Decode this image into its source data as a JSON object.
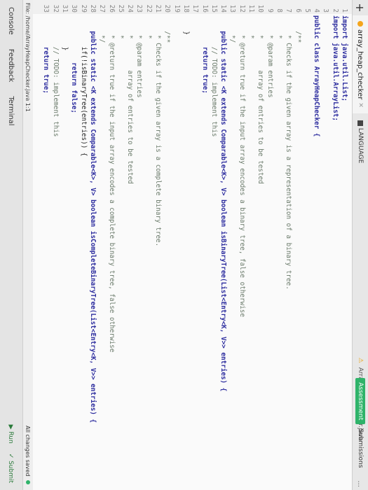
{
  "tabs": {
    "add": "+",
    "active_file": "array_heap_checker",
    "language_label": "LANGUAGE",
    "open_file": "ArrayHeapChecker.java"
  },
  "header": {
    "assessment_label": "Assessment",
    "submissions_label": "Submissions",
    "more": "..."
  },
  "code": {
    "lines": [
      {
        "n": "1",
        "t": "import java.util.List;"
      },
      {
        "n": "2",
        "t": "import java.util.ArrayList;"
      },
      {
        "n": "3",
        "t": ""
      },
      {
        "n": "4",
        "t": "public class ArrayHeapChecker {"
      },
      {
        "n": "5",
        "t": ""
      },
      {
        "n": "6",
        "t": "    /**"
      },
      {
        "n": "7",
        "t": "     * Checks if the given array is a representation of a binary tree."
      },
      {
        "n": "8",
        "t": "     *"
      },
      {
        "n": "9",
        "t": "     * @param entries"
      },
      {
        "n": "10",
        "t": "     *        array of entries to be tested"
      },
      {
        "n": "11",
        "t": "     *"
      },
      {
        "n": "12",
        "t": "     * @return true if the input array encodes a binary tree, false otherwise"
      },
      {
        "n": "13",
        "t": "     */"
      },
      {
        "n": "14",
        "t": "    public static <K extends Comparable<K>, V> boolean isBinaryTree(List<Entry<K, V>> entries) {"
      },
      {
        "n": "15",
        "t": "        // TODO: implement this"
      },
      {
        "n": "16",
        "t": "        return true;"
      },
      {
        "n": "17",
        "t": ""
      },
      {
        "n": "18",
        "t": "    }"
      },
      {
        "n": "19",
        "t": ""
      },
      {
        "n": "20",
        "t": "    /**"
      },
      {
        "n": "21",
        "t": "     * Checks if the given array is a complete binary tree."
      },
      {
        "n": "22",
        "t": "     *"
      },
      {
        "n": "23",
        "t": "     * @param entries"
      },
      {
        "n": "24",
        "t": "     *        array of entries to be tested"
      },
      {
        "n": "25",
        "t": "     *"
      },
      {
        "n": "26",
        "t": "     * @return true if the input array encodes a complete binary tree, false otherwise"
      },
      {
        "n": "27",
        "t": "     */"
      },
      {
        "n": "28",
        "t": "    public static <K extends Comparable<K>, V> boolean isCompleteBinaryTree(List<Entry<K, V>> entries) {"
      },
      {
        "n": "29",
        "t": "        if(!isBinaryTree(entries)) {"
      },
      {
        "n": "30",
        "t": "            return false;"
      },
      {
        "n": "31",
        "t": "        }"
      },
      {
        "n": "32",
        "t": "        // TODO: implement this"
      },
      {
        "n": "33",
        "t": "        return true;"
      }
    ]
  },
  "status": {
    "file_path": "File: /home/ArrayHeapChecker.java 1:1",
    "saved": "All changes saved"
  },
  "bottom": {
    "console": "Console",
    "feedback": "Feedback",
    "terminal": "Terminal",
    "run": "▶ Run",
    "submit": "✓ Submit"
  }
}
